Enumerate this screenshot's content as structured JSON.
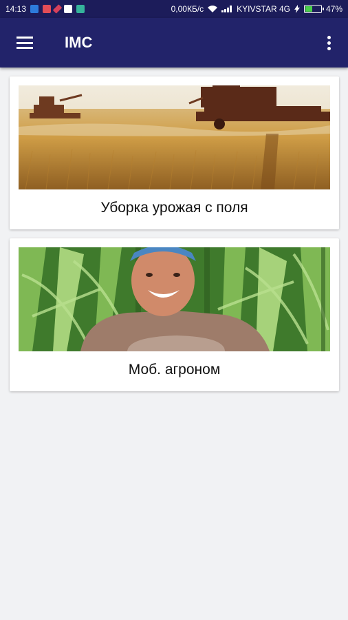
{
  "status_bar": {
    "time": "14:13",
    "network_speed": "0,00КБ/с",
    "carrier": "KYIVSTAR 4G",
    "battery": "47%",
    "battery_level": 0.47
  },
  "app_bar": {
    "title": "IMC"
  },
  "cards": [
    {
      "label": "Уборка урожая с поля",
      "image": "wheat-harvest-combines"
    },
    {
      "label": "Моб. агроном",
      "image": "agronomist-cornfield"
    }
  ],
  "colors": {
    "status_bar": "#1c1c5a",
    "app_bar": "#22236a",
    "background": "#f1f2f4",
    "card": "#ffffff"
  }
}
